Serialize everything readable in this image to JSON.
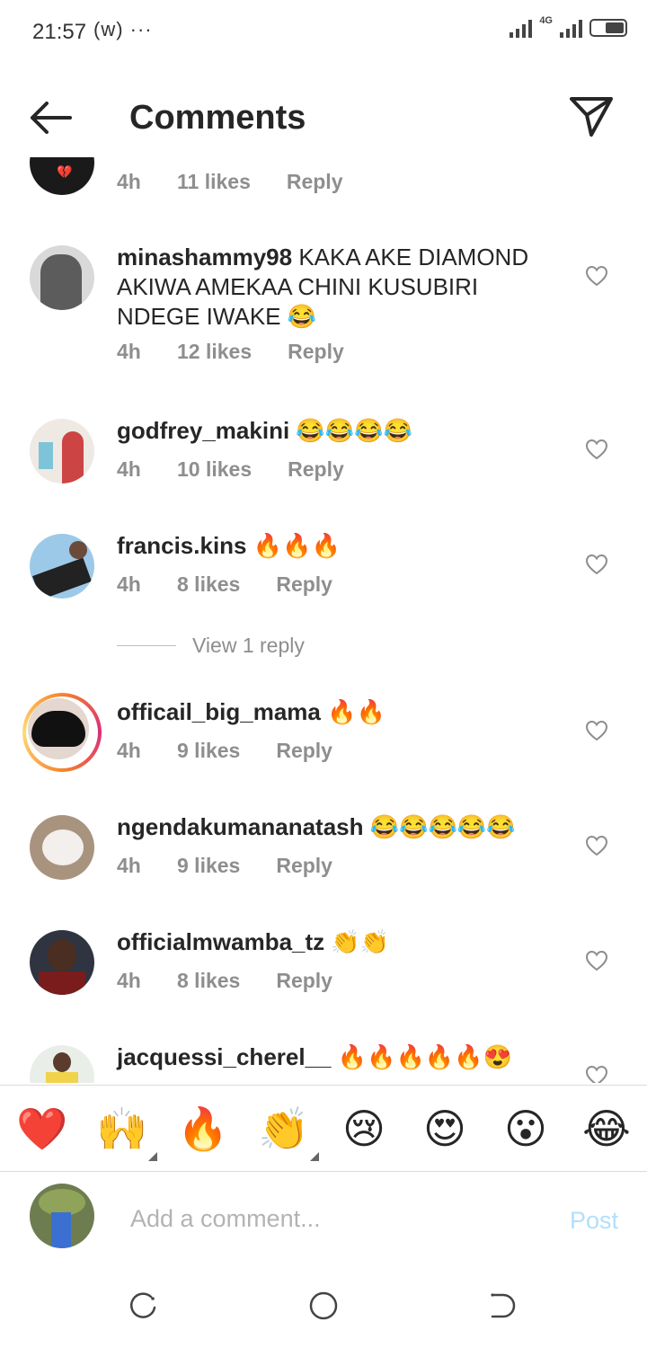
{
  "status_bar": {
    "time": "21:57",
    "extra": "(ᴡ) ···",
    "network": "4G"
  },
  "header": {
    "title": "Comments"
  },
  "comments": [
    {
      "meta": {
        "time": "4h",
        "likes": "11 likes",
        "reply": "Reply"
      }
    },
    {
      "username": "minashammy98",
      "text": "KAKA AKE DIAMOND AKIWA AMEKAA CHINI KUSUBIRI NDEGE IWAKE 😂",
      "meta": {
        "time": "4h",
        "likes": "12 likes",
        "reply": "Reply"
      }
    },
    {
      "username": "godfrey_makini",
      "text": "😂😂😂😂",
      "meta": {
        "time": "4h",
        "likes": "10 likes",
        "reply": "Reply"
      }
    },
    {
      "username": "francis.kins",
      "text": "🔥🔥🔥",
      "meta": {
        "time": "4h",
        "likes": "8 likes",
        "reply": "Reply"
      }
    },
    {
      "username": "officail_big_mama",
      "text": "🔥🔥",
      "meta": {
        "time": "4h",
        "likes": "9 likes",
        "reply": "Reply"
      }
    },
    {
      "username": "ngendakumananatash",
      "text": "😂😂😂😂😂",
      "meta": {
        "time": "4h",
        "likes": "9 likes",
        "reply": "Reply"
      }
    },
    {
      "username": "officialmwamba_tz",
      "text": "👏👏",
      "meta": {
        "time": "4h",
        "likes": "8 likes",
        "reply": "Reply"
      }
    },
    {
      "username": "jacquessi_cherel__",
      "text": "🔥🔥🔥🔥🔥😍"
    }
  ],
  "view_replies": "View 1 reply",
  "reactions": [
    "❤️",
    "🙌",
    "🔥",
    "👏",
    "😢",
    "😍",
    "😮",
    "😂"
  ],
  "composer": {
    "placeholder": "Add a comment...",
    "post": "Post"
  },
  "colors": {
    "text": "#262626",
    "secondary": "#8e8e8e",
    "post_disabled": "#b2dffc",
    "story_ring": "#dd2a7b"
  },
  "icons": {
    "back": "arrow-left-icon",
    "send": "paper-plane-icon",
    "like": "heart-outline-icon",
    "nav_recent": "recent-apps-icon",
    "nav_home": "home-circle-icon",
    "nav_back": "back-icon"
  }
}
